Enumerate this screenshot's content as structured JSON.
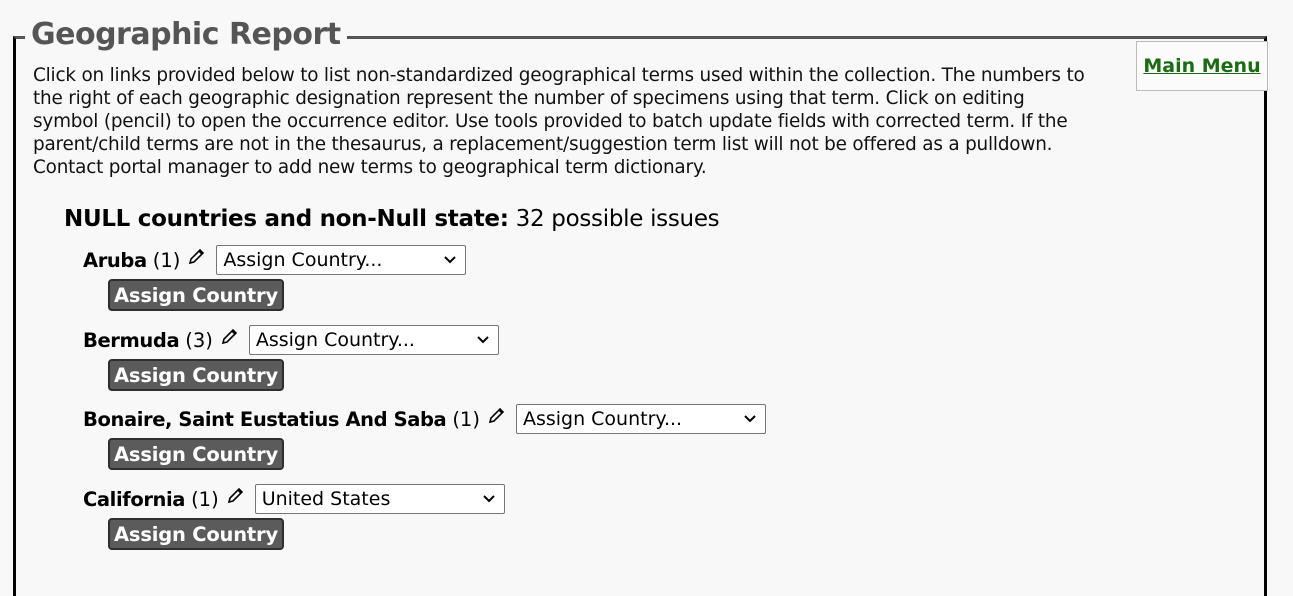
{
  "report": {
    "title": "Geographic Report",
    "main_menu_label": "Main Menu",
    "intro": "Click on links provided below to list non-standardized geographical terms used within the collection. The numbers to the right of each geographic designation represent the number of specimens using that term. Click on editing symbol (pencil) to open the occurrence editor. Use tools provided to batch update fields with corrected term. If the parent/child terms are not in the thesaurus, a replacement/suggestion term list will not be offered as a pulldown. Contact portal manager to add new terms to geographical term dictionary."
  },
  "section": {
    "heading": "NULL countries and non-Null state:",
    "count": "32 possible issues"
  },
  "items": [
    {
      "name": "Aruba",
      "count": "(1)",
      "select_value": "Assign Country...",
      "button": "Assign Country"
    },
    {
      "name": "Bermuda",
      "count": "(3)",
      "select_value": "Assign Country...",
      "button": "Assign Country"
    },
    {
      "name": "Bonaire, Saint Eustatius And Saba",
      "count": "(1)",
      "select_value": "Assign Country...",
      "button": "Assign Country"
    },
    {
      "name": "California",
      "count": "(1)",
      "select_value": "United States",
      "button": "Assign Country"
    }
  ],
  "icons": {
    "edit": "pencil-icon",
    "dropdown": "chevron-down-icon"
  },
  "colors": {
    "link": "#1b6b12",
    "button_bg": "#5b5b5b",
    "legend_text": "#555555"
  }
}
